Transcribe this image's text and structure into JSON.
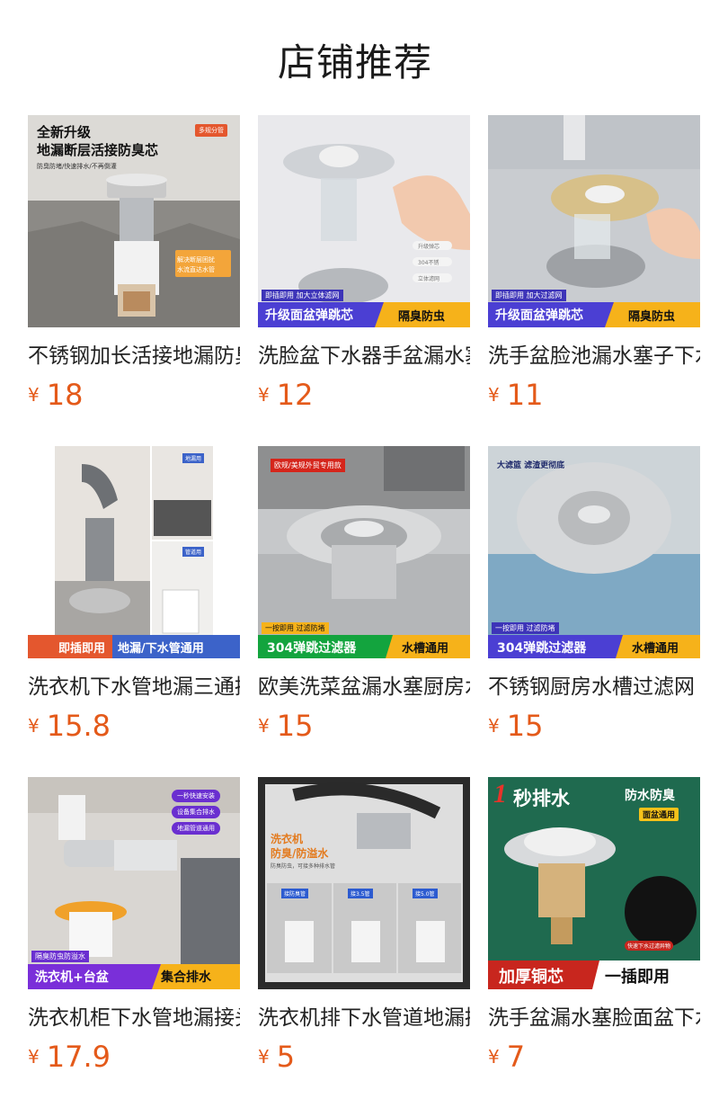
{
  "header": {
    "title": "店铺推荐"
  },
  "currency_symbol": "¥",
  "products": [
    {
      "name": "不锈钢加长活接地漏防臭芯",
      "price": "18",
      "overlay": {
        "headline1": "全新升级",
        "headline2": "地漏断层活接防臭芯",
        "sub": "防臭防堵/快速排水/不再倒灌",
        "badge": "多规分管",
        "note1": "解决断层困扰",
        "note2": "水流直达水管"
      }
    },
    {
      "name": "洗脸盆下水器手盆漏水塞",
      "price": "12",
      "overlay": {
        "top_tag": "即插即用 加大立体滤网",
        "left": "升级面盆弹跳芯",
        "right": "隔臭防虫",
        "chips": [
          "升级弹芯",
          "304不锈",
          "立体滤网"
        ]
      }
    },
    {
      "name": "洗手盆脸池漏水塞子下水器",
      "price": "11",
      "overlay": {
        "top_tag": "即插即用 加大过滤网",
        "left": "升级面盆弹跳芯",
        "right": "隔臭防虫"
      }
    },
    {
      "name": "洗衣机下水管地漏三通接头",
      "price": "15.8",
      "overlay": {
        "left": "即插即用",
        "right": "地漏/下水管通用",
        "chip1": "地漏用",
        "chip2": "管道用"
      }
    },
    {
      "name": "欧美洗菜盆漏水塞厨房水槽",
      "price": "15",
      "overlay": {
        "badge": "欧规/美规外贸专用款",
        "top_tag": "一按即用 过滤防堵",
        "left": "304弹跳过滤器",
        "right": "水槽通用"
      }
    },
    {
      "name": "不锈钢厨房水槽过滤网",
      "price": "15",
      "overlay": {
        "badge": "大滤篮 滤渣更彻底",
        "top_tag": "一按即用 过滤防堵",
        "left": "304弹跳过滤器",
        "right": "水槽通用"
      }
    },
    {
      "name": "洗衣机柜下水管地漏接头",
      "price": "17.9",
      "overlay": {
        "pills": [
          "一秒快速安装",
          "设备集合排水",
          "地漏管道通用"
        ],
        "top_tag": "隔臭防虫防溢水",
        "left": "洗衣机+台盆",
        "right": "集合排水"
      }
    },
    {
      "name": "洗衣机排下水管道地漏接头",
      "price": "5",
      "overlay": {
        "headline1": "洗衣机",
        "headline2": "防臭/防溢水",
        "sub": "防臭防虫，可接多种排水管",
        "tags": [
          "接防臭管",
          "接3.5管",
          "接5.0管"
        ]
      }
    },
    {
      "name": "洗手盆漏水塞脸面盆下水器",
      "price": "7",
      "overlay": {
        "headline_num": "1",
        "headline": "秒排水",
        "right1": "防水防臭",
        "right2": "面盆通用",
        "bubble": "快速下水过滤异物",
        "left": "加厚铜芯",
        "right": "一插即用"
      }
    }
  ]
}
